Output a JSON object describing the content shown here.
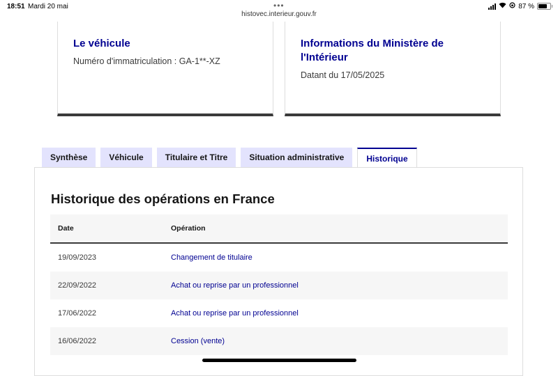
{
  "status_bar": {
    "time": "18:51",
    "date": "Mardi 20 mai",
    "url": "histovec.interieur.gouv.fr",
    "battery": "87 %",
    "battery_level": 0.87
  },
  "cards": {
    "vehicle": {
      "title": "Le véhicule",
      "registration": "Numéro d'immatriculation : GA-1**-XZ"
    },
    "ministry": {
      "title": "Informations du Ministère de l'Intérieur",
      "date": "Datant du 17/05/2025"
    }
  },
  "tabs": [
    {
      "label": "Synthèse",
      "active": false
    },
    {
      "label": "Véhicule",
      "active": false
    },
    {
      "label": "Titulaire et Titre",
      "active": false
    },
    {
      "label": "Situation administrative",
      "active": false
    },
    {
      "label": "Historique",
      "active": true
    }
  ],
  "history": {
    "title": "Historique des opérations en France",
    "columns": {
      "date": "Date",
      "operation": "Opération"
    },
    "rows": [
      {
        "date": "19/09/2023",
        "operation": "Changement de titulaire"
      },
      {
        "date": "22/09/2022",
        "operation": "Achat ou reprise par un professionnel"
      },
      {
        "date": "17/06/2022",
        "operation": "Achat ou reprise par un professionnel"
      },
      {
        "date": "16/06/2022",
        "operation": "Cession (vente)"
      }
    ]
  },
  "colors": {
    "accent": "#000091",
    "tab_background": "#e3e3fd",
    "row_alt": "#f6f6f6"
  }
}
